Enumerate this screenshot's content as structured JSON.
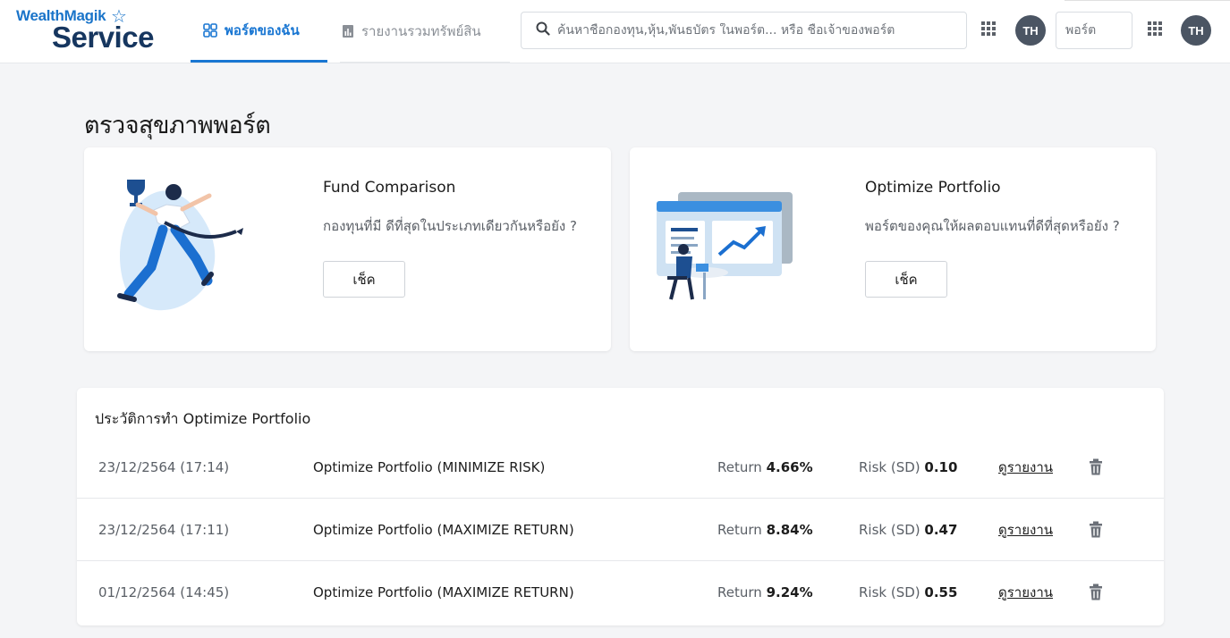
{
  "header": {
    "logo_top": "WealthMagik",
    "logo_bottom": "Service",
    "tabs": [
      {
        "label": "พอร์ตของฉัน",
        "active": true
      },
      {
        "label": "รายงานรวมทรัพย์สิน",
        "active": false
      }
    ],
    "search_placeholder": "ค้นหาชื่อกองทุน,หุ้น,พันธบัตร ในพอร์ต... หรือ ชื่อเจ้าของพอร์ต",
    "avatar_initials": "TH",
    "mini_input_text": "พอร์ต"
  },
  "main": {
    "page_title": "ตรวจสุขภาพพอร์ต",
    "cards": [
      {
        "title": "Fund Comparison",
        "desc": "กองทุนที่มี ดีที่สุดในประเภทเดียวกันหรือยัง ?",
        "button": "เช็ค"
      },
      {
        "title": "Optimize Portfolio",
        "desc": "พอร์ตของคุณให้ผลตอบแทนที่ดีที่สุดหรือยัง ?",
        "button": "เช็ค"
      }
    ],
    "history": {
      "title": "ประวัติการทำ Optimize Portfolio",
      "return_label": "Return",
      "risk_label": "Risk (SD)",
      "link_label": "ดูรายงาน",
      "rows": [
        {
          "date": "23/12/2564 (17:14)",
          "name": "Optimize Portfolio (MINIMIZE RISK)",
          "return": "4.66%",
          "risk": "0.10"
        },
        {
          "date": "23/12/2564 (17:11)",
          "name": "Optimize Portfolio (MAXIMIZE RETURN)",
          "return": "8.84%",
          "risk": "0.47"
        },
        {
          "date": "01/12/2564 (14:45)",
          "name": "Optimize Portfolio (MAXIMIZE RETURN)",
          "return": "9.24%",
          "risk": "0.55"
        }
      ]
    }
  },
  "colors": {
    "accent": "#1976d2",
    "logo_blue": "#1a74c9",
    "logo_navy": "#16365f",
    "avatar_bg": "#4b5563"
  },
  "icons": {
    "tab_1": "grid-icon",
    "tab_2": "report-icon",
    "search": "search-icon",
    "apps": "apps-grid-icon",
    "delete": "trash-icon"
  }
}
